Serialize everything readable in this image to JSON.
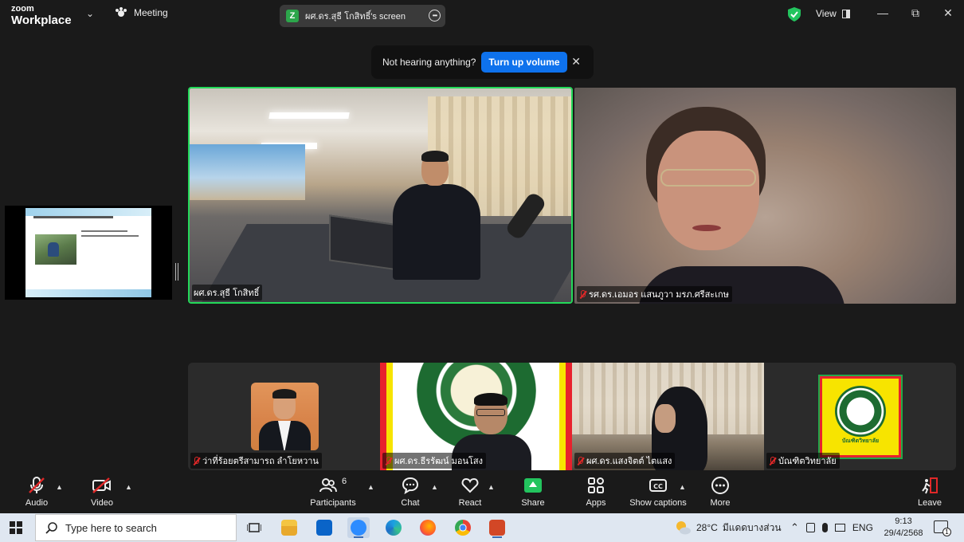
{
  "app": {
    "logo_line1": "zoom",
    "logo_line2": "Workplace",
    "meeting_menu": "Meeting",
    "screen_share_badge": "Z",
    "screen_share_title": "ผศ.ดร.สุธี โกสิทธิ์'s screen",
    "view_label": "View",
    "accent_color": "#0e72ed",
    "active_speaker_border": "#23d959"
  },
  "banner": {
    "message": "Not hearing anything?",
    "button": "Turn up volume"
  },
  "participants": [
    {
      "name": "ผศ.ดร.สุธี โกสิทธิ์",
      "muted": true
    },
    {
      "name": "รศ.ดร.เอมอร แสนภูวา มรภ.ศรีสะเกษ",
      "muted": true
    },
    {
      "name": "ว่าที่ร้อยตรีสามารถ ลำโยหวาน",
      "muted": true
    },
    {
      "name": "ผศ.ดร.ธีรรัฒน์ มอนโสง",
      "muted": true
    },
    {
      "name": "ผศ.ดร.แสงจิตต์ ไตแสง",
      "muted": true
    },
    {
      "name": "บัณฑิตวิทยาลัย",
      "muted": true
    }
  ],
  "tile6_logo_text": "บัณฑิตวิทยาลัย",
  "controls": {
    "audio": "Audio",
    "video": "Video",
    "participants": "Participants",
    "participants_count": "6",
    "chat": "Chat",
    "react": "React",
    "share": "Share",
    "apps": "Apps",
    "captions": "Show captions",
    "more": "More",
    "leave": "Leave"
  },
  "taskbar": {
    "search_placeholder": "Type here to search",
    "weather_temp": "28°C",
    "weather_desc": "มีแดดบางส่วน",
    "language": "ENG",
    "time": "9:13",
    "date": "29/4/2568",
    "notification_count": "1"
  }
}
